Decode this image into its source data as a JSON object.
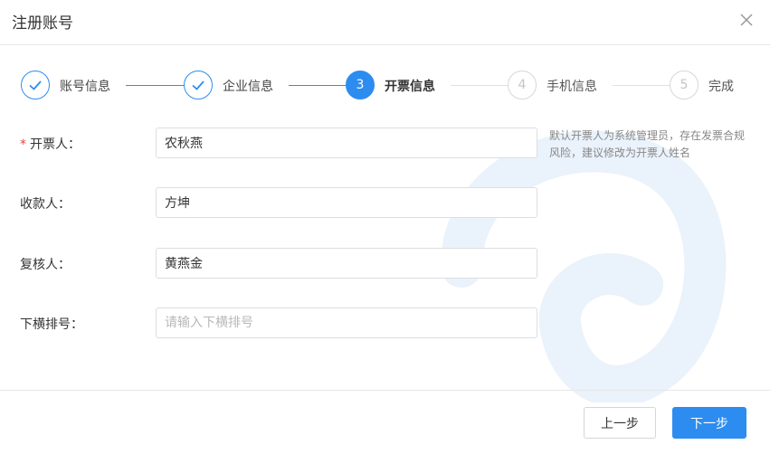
{
  "dialog": {
    "title": "注册账号"
  },
  "steps": [
    {
      "index": "1",
      "label": "账号信息",
      "status": "done"
    },
    {
      "index": "2",
      "label": "企业信息",
      "status": "done"
    },
    {
      "index": "3",
      "label": "开票信息",
      "status": "active"
    },
    {
      "index": "4",
      "label": "手机信息",
      "status": "todo"
    },
    {
      "index": "5",
      "label": "完成",
      "status": "todo"
    }
  ],
  "form": {
    "required_mark": "*",
    "drawer": {
      "label": "开票人：",
      "value": "农秋燕"
    },
    "payee": {
      "label": "收款人：",
      "value": "方坤"
    },
    "reviewer": {
      "label": "复核人：",
      "value": "黄燕金"
    },
    "extra": {
      "label": "下横排号：",
      "value": "",
      "placeholder": "请输入下横排号"
    },
    "hint": "默认开票人为系统管理员，存在发票合规风险，建议修改为开票人姓名"
  },
  "footer": {
    "prev_label": "上一步",
    "next_label": "下一步"
  },
  "colors": {
    "primary": "#2d8cf0",
    "required": "#e8453c",
    "todo": "#d7d7d7"
  },
  "icons": {
    "close": "close-icon",
    "done_step": "check-icon"
  }
}
